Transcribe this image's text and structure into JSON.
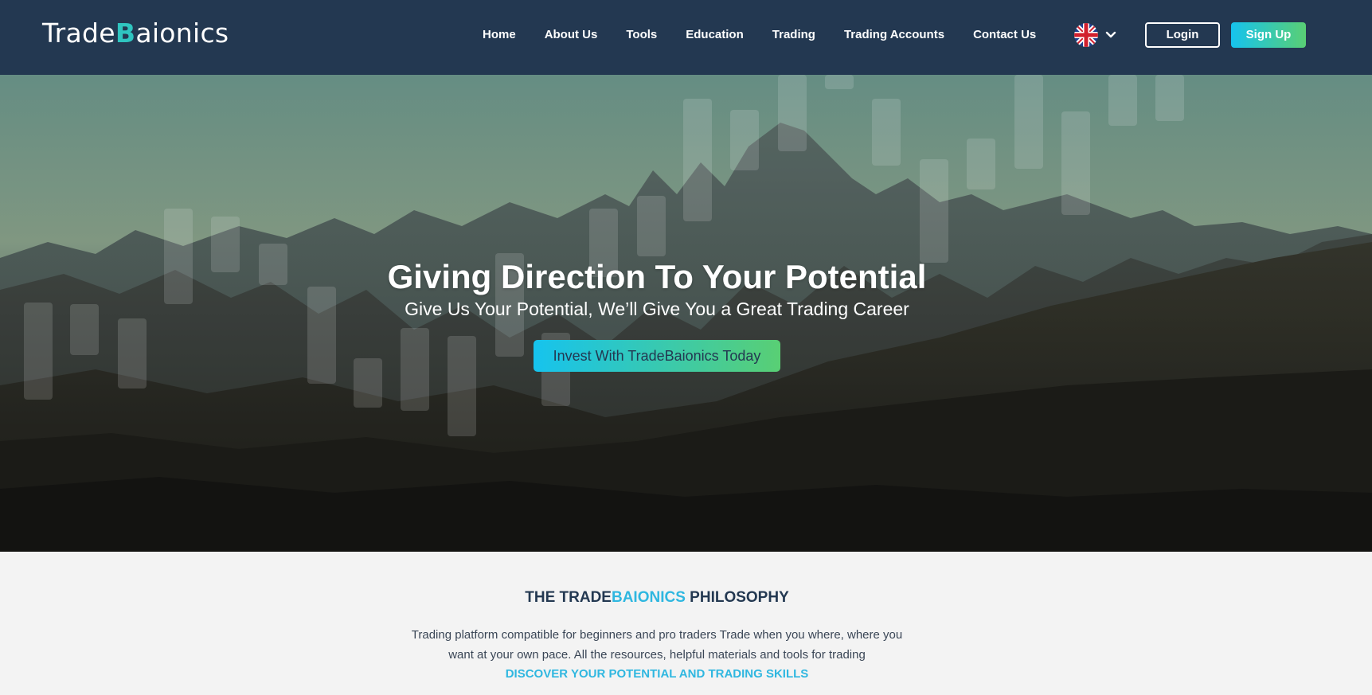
{
  "nav": {
    "logo": {
      "prefix": "Trade",
      "mark": "B",
      "suffix": "aionics"
    },
    "links": [
      "Home",
      "About Us",
      "Tools",
      "Education",
      "Trading",
      "Trading Accounts",
      "Contact Us"
    ],
    "language_icon": "uk-flag-icon",
    "language_chevron_icon": "chevron-down-icon",
    "login_label": "Login",
    "signup_label": "Sign Up"
  },
  "hero": {
    "title": "Giving Direction To Your Potential",
    "subtitle": "Give Us Your Potential, We’ll Give You a Great Trading Career",
    "cta_label": "Invest With TradeBaionics Today"
  },
  "philosophy": {
    "title_prefix": "THE TRADE",
    "title_accent": "BAIONICS",
    "title_suffix": " PHILOSOPHY",
    "text": "Trading platform compatible for beginners and pro traders Trade when you where, where you want at your own pace. All the resources, helpful materials and tools for trading",
    "link": "DISCOVER YOUR POTENTIAL AND TRADING SKILLS"
  },
  "colors": {
    "nav_bg": "#233851",
    "accent_blue": "#2fb7e0",
    "gradient_start": "#16c3ee",
    "gradient_end": "#59cf74",
    "page_bg": "#f3f3f3"
  }
}
